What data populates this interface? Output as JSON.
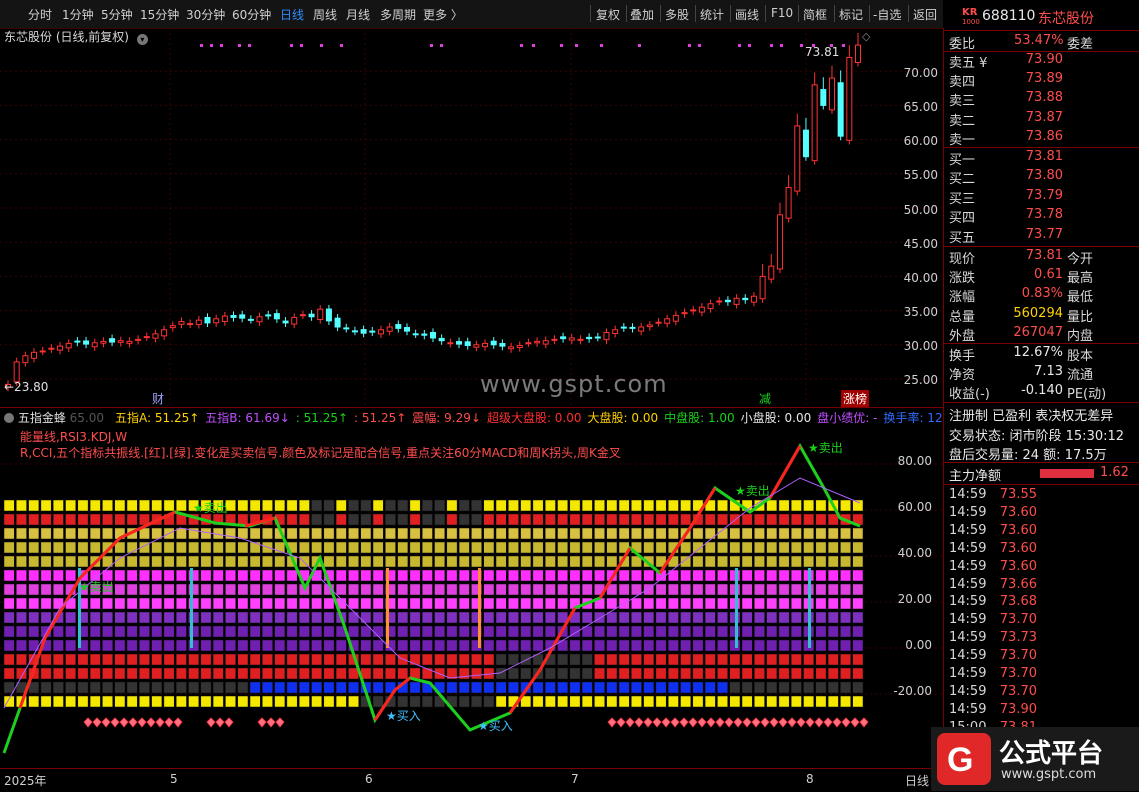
{
  "toolbar": {
    "periods": [
      "分时",
      "1分钟",
      "5分钟",
      "15分钟",
      "30分钟",
      "60分钟",
      "日线",
      "周线",
      "月线",
      "多周期",
      "更多 〉"
    ],
    "active_period": "日线",
    "actions": [
      "复权",
      "叠加",
      "多股",
      "统计",
      "画线",
      "F10",
      "简框",
      "标记",
      "-自选",
      "返回"
    ]
  },
  "main_chart": {
    "title": "东芯股份 (日线,前复权)",
    "y_ticks": [
      "70.00",
      "65.00",
      "60.00",
      "55.00",
      "50.00",
      "45.00",
      "40.00",
      "35.00",
      "30.00",
      "25.00"
    ],
    "high_label": "73.81",
    "low_label": "←23.80",
    "watermark": "www.gspt.com",
    "event_markers": [
      "财",
      "减",
      "涨榜"
    ]
  },
  "indicator": {
    "name": "五指金蜂",
    "name_value": "65.00",
    "readouts": [
      {
        "label": "五指A:",
        "value": "51.25",
        "arrow": "↑",
        "color": "#ffd200"
      },
      {
        "label": "五指B:",
        "value": "61.69",
        "arrow": "↓",
        "color": "#c050ff"
      },
      {
        "label": ":",
        "value": "51.25",
        "arrow": "↑",
        "color": "#19d119"
      },
      {
        "label": ":",
        "value": "51.25",
        "arrow": "↑",
        "color": "#ff4d4d"
      },
      {
        "label": "震幅:",
        "value": "9.29",
        "arrow": "↓",
        "color": "#ff4d4d"
      },
      {
        "label": "超级大盘股:",
        "value": "0.00",
        "arrow": "",
        "color": "#ff3030"
      },
      {
        "label": "大盘股:",
        "value": "0.00",
        "arrow": "",
        "color": "#ffd200"
      },
      {
        "label": "中盘股:",
        "value": "1.00",
        "arrow": "",
        "color": "#19d119"
      },
      {
        "label": "小盘股:",
        "value": "0.00",
        "arrow": "",
        "color": "#e8e8e8"
      },
      {
        "label": "盘小绩优:",
        "value": "-",
        "arrow": "",
        "color": "#c050ff"
      },
      {
        "label": "换手率:",
        "value": "12",
        "arrow": "",
        "color": "#2f6cff"
      }
    ],
    "description_line1": "能量线,RSI3.KDJ,W",
    "description_line2": "R,CCI,五个指标共振线.[红].[绿].变化是买卖信号.颜色及标记是配合信号,重点关注60分MACD和周K拐头,周K金叉",
    "y_ticks": [
      "80.00",
      "60.00",
      "40.00",
      "20.00",
      "0.00",
      "-20.00"
    ],
    "signals": [
      {
        "text": "★卖出",
        "color": "#19d119"
      },
      {
        "text": "★卖出",
        "color": "#19d119"
      },
      {
        "text": "★卖出",
        "color": "#19d119"
      },
      {
        "text": "★卖出",
        "color": "#19d119"
      },
      {
        "text": "★买入",
        "color": "#40c0ff"
      },
      {
        "text": "★买入",
        "color": "#40c0ff"
      }
    ]
  },
  "time_axis": {
    "labels": [
      "2025年",
      "5",
      "6",
      "7",
      "8"
    ],
    "corner_label": "日线"
  },
  "quote": {
    "market_tag": "KR",
    "market_sub": "1000",
    "code": "688110",
    "name": "东芯股份",
    "weibi_label": "委比",
    "weibi_value": "53.47%",
    "weicha_label": "委差",
    "asks": [
      {
        "label": "卖五 ¥",
        "price": "73.90"
      },
      {
        "label": "卖四",
        "price": "73.89"
      },
      {
        "label": "卖三",
        "price": "73.88"
      },
      {
        "label": "卖二",
        "price": "73.87"
      },
      {
        "label": "卖一",
        "price": "73.86"
      }
    ],
    "bids": [
      {
        "label": "买一",
        "price": "73.81"
      },
      {
        "label": "买二",
        "price": "73.80"
      },
      {
        "label": "买三",
        "price": "73.79"
      },
      {
        "label": "买四",
        "price": "73.78"
      },
      {
        "label": "买五",
        "price": "73.77"
      }
    ],
    "stats": [
      {
        "label": "现价",
        "value": "73.81",
        "color": "#ff4d4d",
        "right": "今开"
      },
      {
        "label": "涨跌",
        "value": "0.61",
        "color": "#ff4d4d",
        "right": "最高"
      },
      {
        "label": "涨幅",
        "value": "0.83%",
        "color": "#ff4d4d",
        "right": "最低"
      },
      {
        "label": "总量",
        "value": "560294",
        "color": "#ffd200",
        "right": "量比"
      },
      {
        "label": "外盘",
        "value": "267047",
        "color": "#ff4d4d",
        "right": "内盘"
      }
    ],
    "stats2": [
      {
        "label": "换手",
        "value": "12.67%",
        "right": "股本"
      },
      {
        "label": "净资",
        "value": "7.13",
        "right": "流通"
      },
      {
        "label": "收益(-)",
        "value": "-0.140",
        "right": "PE(动)"
      }
    ],
    "info1": "注册制 已盈利 表决权无差异",
    "info2": "交易状态: 闭市阶段 15:30:12",
    "info3": "盘后交易量: 24  额: 17.5万",
    "net_label": "主力净额",
    "net_value": "1.62",
    "ticks": [
      {
        "time": "14:59",
        "price": "73.55"
      },
      {
        "time": "14:59",
        "price": "73.60"
      },
      {
        "time": "14:59",
        "price": "73.60"
      },
      {
        "time": "14:59",
        "price": "73.60"
      },
      {
        "time": "14:59",
        "price": "73.60"
      },
      {
        "time": "14:59",
        "price": "73.66"
      },
      {
        "time": "14:59",
        "price": "73.68"
      },
      {
        "time": "14:59",
        "price": "73.70"
      },
      {
        "time": "14:59",
        "price": "73.73"
      },
      {
        "time": "14:59",
        "price": "73.70"
      },
      {
        "time": "14:59",
        "price": "73.70"
      },
      {
        "time": "14:59",
        "price": "73.70"
      },
      {
        "time": "14:59",
        "price": "73.90"
      },
      {
        "time": "15:00",
        "price": "73.81"
      }
    ]
  },
  "badge": {
    "text": "公式平台",
    "url": "www.gspt.com"
  }
}
